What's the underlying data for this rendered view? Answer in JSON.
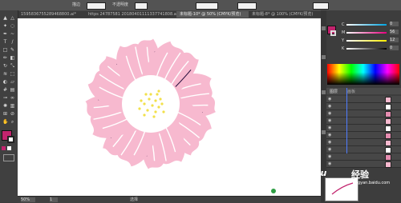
{
  "tabs": [
    {
      "label": "1595836755289468800.ai*"
    },
    {
      "label": "https 24787581 20180401111337741808.ai*"
    },
    {
      "label": "未标题-10* @ 50% (CMYK/预览)"
    },
    {
      "label": "未标题-8* @ 100% (CMYK/预览)"
    }
  ],
  "control_bar": {
    "label_a": "描边",
    "label_b": "不透明度",
    "value_a": "1 pt",
    "value_b": "100%"
  },
  "statusbar": {
    "zoom": "50%",
    "page": "1",
    "mode": "选择"
  },
  "color_panel": {
    "channels": [
      "C",
      "M",
      "Y",
      "K"
    ],
    "values": [
      "0",
      "56",
      "12",
      "0"
    ]
  },
  "layers_panel": {
    "tabs": [
      "图层",
      "画板"
    ],
    "rows": 10
  },
  "watermark": {
    "brand": "Baidu",
    "brand_cn": "经验",
    "sub": "jingyan.baidu.com"
  },
  "colors": {
    "petal_pink": "#f7b9cf",
    "petal_dark": "#2c1340",
    "center_yellow": "#f2e04a",
    "fill_swatch": "#c2246e",
    "ui_dark": "#3c3c3c"
  },
  "icons": [
    "selection-tool-icon",
    "direct-selection-icon",
    "pen-icon",
    "type-icon",
    "line-icon",
    "rectangle-icon",
    "brush-icon",
    "pencil-icon",
    "rotate-icon",
    "scale-icon",
    "eyedropper-icon",
    "zoom-icon",
    "hand-icon",
    "eye-icon"
  ]
}
